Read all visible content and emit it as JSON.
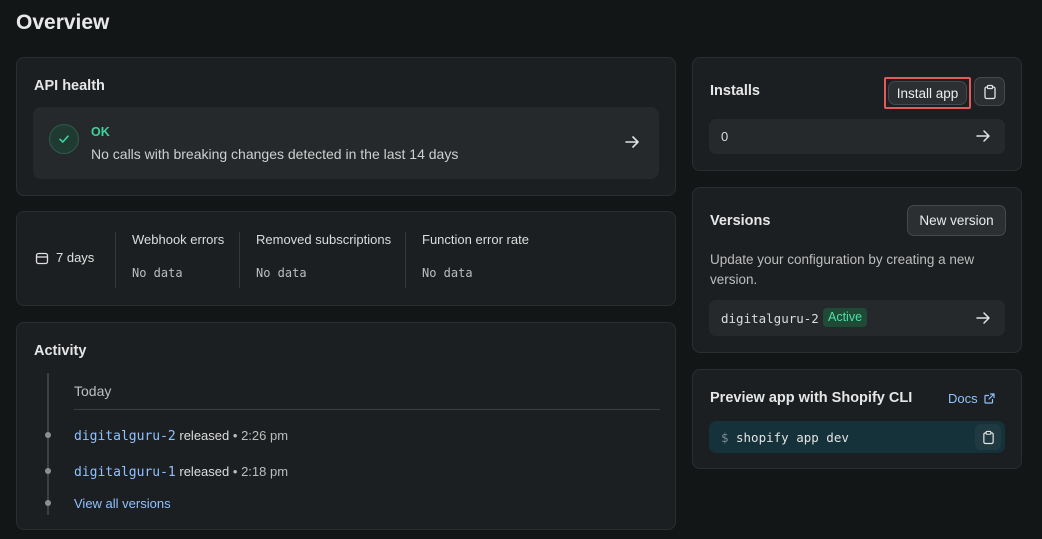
{
  "page": {
    "title": "Overview"
  },
  "api_health": {
    "title": "API health",
    "status": "OK",
    "description": "No calls with breaking changes detected in the last 14 days",
    "status_color": "#3fd29a",
    "icons": {
      "status": "check-circle-icon",
      "arrow": "arrow-right-icon"
    }
  },
  "metrics": {
    "range_label": "7 days",
    "range_icon": "calendar-icon",
    "items": [
      {
        "label": "Webhook errors",
        "value": "No data"
      },
      {
        "label": "Removed subscriptions",
        "value": "No data"
      },
      {
        "label": "Function error rate",
        "value": "No data"
      }
    ]
  },
  "activity": {
    "title": "Activity",
    "group_label": "Today",
    "items": [
      {
        "version": "digitalguru-2",
        "action": "released",
        "separator": "•",
        "time": "2:26 pm"
      },
      {
        "version": "digitalguru-1",
        "action": "released",
        "separator": "•",
        "time": "2:18 pm"
      }
    ],
    "view_all_label": "View all versions"
  },
  "installs": {
    "title": "Installs",
    "install_button_label": "Install app",
    "copy_icon": "clipboard-icon",
    "count": "0"
  },
  "versions": {
    "title": "Versions",
    "new_version_label": "New version",
    "description": "Update your configuration by creating a new version.",
    "current": {
      "name": "digitalguru-2",
      "badge": "Active"
    },
    "badge_color": "#4fe0a5"
  },
  "preview": {
    "title": "Preview app with Shopify CLI",
    "docs_label": "Docs",
    "docs_icon": "external-link-icon",
    "prompt": "$",
    "command": "shopify app dev",
    "copy_icon": "clipboard-icon"
  },
  "colors": {
    "background": "#131617",
    "card": "#1c1f21",
    "link": "#8fc1ff",
    "highlight_border": "#e25b5b"
  }
}
